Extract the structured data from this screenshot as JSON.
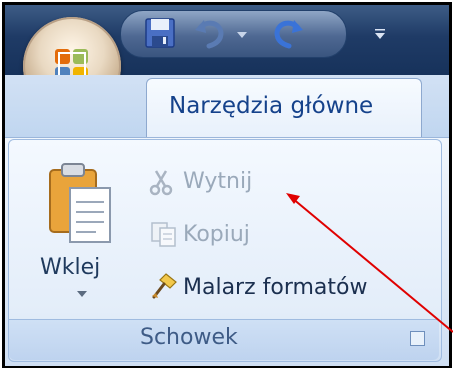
{
  "quick_access": {
    "icons": [
      "office-button-icon",
      "save-icon",
      "undo-icon",
      "undo-dropdown-icon",
      "redo-icon",
      "customize-qat-icon"
    ]
  },
  "tab": {
    "label": "Narzędzia główne"
  },
  "clipboard_group": {
    "label": "Schowek",
    "paste": {
      "label": "Wklej"
    },
    "commands": [
      {
        "label": "Wytnij",
        "icon": "scissors-icon",
        "enabled": false
      },
      {
        "label": "Kopiuj",
        "icon": "copy-icon",
        "enabled": false
      },
      {
        "label": "Malarz formatów",
        "icon": "format-painter-icon",
        "enabled": true
      }
    ]
  },
  "annotation": {
    "color": "#e00000",
    "target": "Wytnij"
  },
  "colors": {
    "title_bar": "#1f3b66",
    "tab_text": "#15428b",
    "ribbon_bg": "#dde8f6"
  }
}
